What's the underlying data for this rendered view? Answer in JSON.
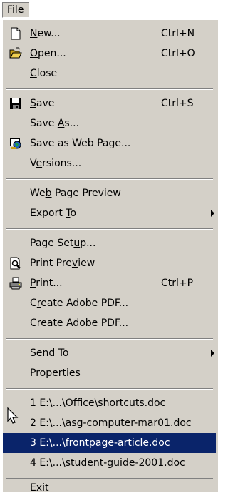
{
  "menubar": {
    "file_label": "File"
  },
  "menu": {
    "new": {
      "pre": "",
      "acc": "N",
      "post": "ew...",
      "shortcut": "Ctrl+N",
      "icon": "new-document-icon"
    },
    "open": {
      "pre": "",
      "acc": "O",
      "post": "pen...",
      "shortcut": "Ctrl+O",
      "icon": "open-folder-icon"
    },
    "close": {
      "pre": "",
      "acc": "C",
      "post": "lose"
    },
    "save": {
      "pre": "",
      "acc": "S",
      "post": "ave",
      "shortcut": "Ctrl+S",
      "icon": "floppy-disk-icon"
    },
    "save_as": {
      "pre": "Save ",
      "acc": "A",
      "post": "s..."
    },
    "save_web": {
      "pre": "Save as Web Page...",
      "acc": "",
      "post": "",
      "icon": "web-page-icon"
    },
    "versions": {
      "pre": "V",
      "acc": "e",
      "post": "rsions..."
    },
    "web_preview": {
      "pre": "We",
      "acc": "b",
      "post": " Page Preview"
    },
    "export_to": {
      "pre": "Export ",
      "acc": "T",
      "post": "o"
    },
    "page_setup": {
      "pre": "Page Set",
      "acc": "u",
      "post": "p..."
    },
    "print_preview": {
      "pre": "Print Pre",
      "acc": "v",
      "post": "iew",
      "icon": "print-preview-icon"
    },
    "print": {
      "pre": "",
      "acc": "P",
      "post": "rint...",
      "shortcut": "Ctrl+P",
      "icon": "printer-icon"
    },
    "pdf1": {
      "pre": "C",
      "acc": "r",
      "post": "eate Adobe PDF..."
    },
    "pdf2": {
      "pre": "Cr",
      "acc": "e",
      "post": "ate Adobe PDF..."
    },
    "send_to": {
      "pre": "Sen",
      "acc": "d",
      "post": " To"
    },
    "properties": {
      "pre": "Propert",
      "acc": "i",
      "post": "es"
    },
    "recent1": {
      "pre": "",
      "acc": "1",
      "post": " E:\\...\\Office\\shortcuts.doc"
    },
    "recent2": {
      "pre": "",
      "acc": "2",
      "post": " E:\\...\\asg-computer-mar01.doc"
    },
    "recent3": {
      "pre": "",
      "acc": "3",
      "post": " E:\\...\\frontpage-article.doc"
    },
    "recent4": {
      "pre": "",
      "acc": "4",
      "post": " E:\\...\\student-guide-2001.doc"
    },
    "exit": {
      "pre": "E",
      "acc": "x",
      "post": "it"
    }
  },
  "colors": {
    "menu_bg": "#d4d0c8",
    "highlight": "#0a246a",
    "highlight_text": "#ffffff"
  }
}
